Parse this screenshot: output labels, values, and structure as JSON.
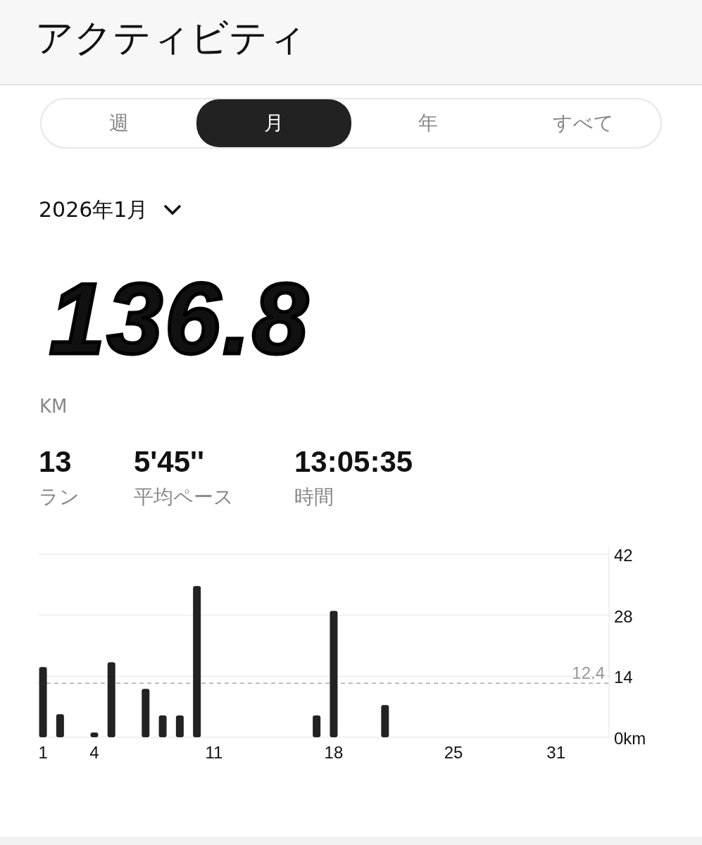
{
  "header": {
    "title": "アクティビティ"
  },
  "tabs": [
    {
      "label": "週",
      "selected": false
    },
    {
      "label": "月",
      "selected": true
    },
    {
      "label": "年",
      "selected": false
    },
    {
      "label": "すべて",
      "selected": false
    }
  ],
  "period": {
    "label": "2026年1月"
  },
  "total": {
    "value": "136.8",
    "unit": "KM"
  },
  "stats": [
    {
      "value": "13",
      "label": "ラン"
    },
    {
      "value": "5'45''",
      "label": "平均ペース"
    },
    {
      "value": "13:05:35",
      "label": "時間"
    }
  ],
  "chart_data": {
    "type": "bar",
    "x": [
      1,
      2,
      4,
      5,
      7,
      8,
      9,
      10,
      17,
      18,
      21
    ],
    "values": [
      16.1,
      5.3,
      1.1,
      17.2,
      11.1,
      5.0,
      5.0,
      34.7,
      5.0,
      29.0,
      7.4
    ],
    "xlim": [
      0.75,
      34.1
    ],
    "xticks": [
      1,
      4,
      11,
      18,
      25,
      31
    ],
    "ylim": [
      0,
      42
    ],
    "yticks": [
      {
        "value": 0,
        "label": "0km"
      },
      {
        "value": 14,
        "label": "14"
      },
      {
        "value": 28,
        "label": "28"
      },
      {
        "value": 42,
        "label": "42"
      }
    ],
    "ref_lines": [
      {
        "axis": "y",
        "value": 12.4,
        "label": "12.4"
      }
    ]
  }
}
